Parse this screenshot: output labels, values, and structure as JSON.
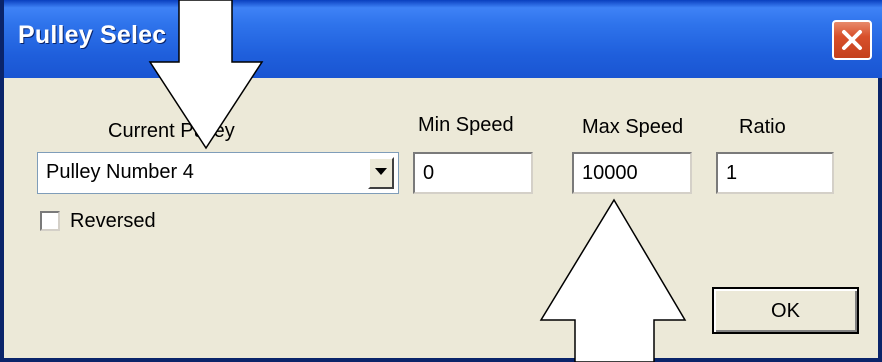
{
  "window": {
    "title": "Pulley Selec",
    "close_label": "close"
  },
  "form": {
    "current_pulley_label": "Current Pulley",
    "current_pulley_value": "Pulley Number 4",
    "min_speed_label": "Min Speed",
    "min_speed_value": "0",
    "max_speed_label": "Max Speed",
    "max_speed_value": "10000",
    "ratio_label": "Ratio",
    "ratio_value": "1",
    "reversed_label": "Reversed",
    "reversed_checked": false,
    "ok_label": "OK"
  },
  "icons": {
    "close": "close-icon",
    "dropdown": "chevron-down-icon",
    "arrow_down": "arrow-down-annotation-icon",
    "arrow_up": "arrow-up-annotation-icon"
  },
  "colors": {
    "titlebar": "#1f5fdc",
    "window_bg": "#ece9d8",
    "close_button": "#d8502b",
    "annotation_fill": "#ffffff"
  }
}
